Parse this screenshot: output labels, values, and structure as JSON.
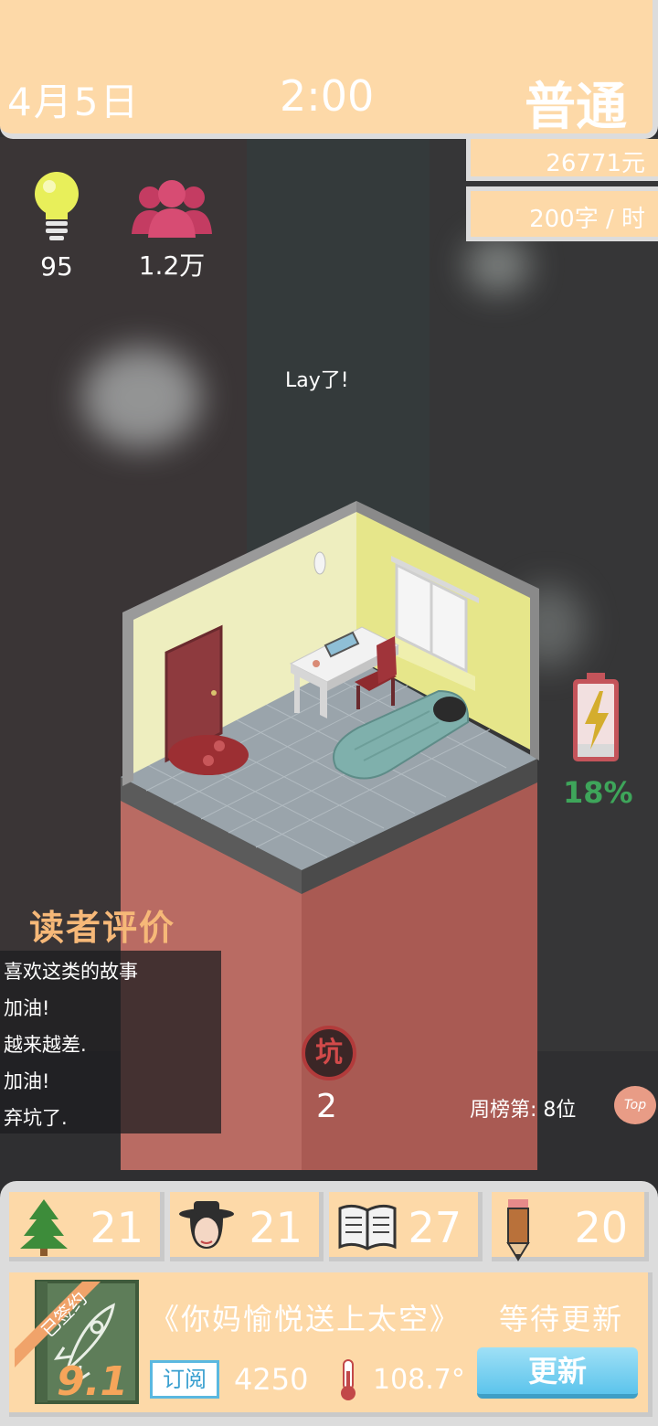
{
  "topbar": {
    "date": "4月5日",
    "time": "2:00",
    "difficulty": "普通"
  },
  "money": "26771元",
  "speed": "200字 / 时",
  "stats": {
    "inspiration": "95",
    "fans": "1.2万"
  },
  "speech": "Lay了!",
  "battery": {
    "percent_label": "18%",
    "level": 0.18
  },
  "reviews": {
    "title": "读者评价",
    "items": [
      "喜欢这类的故事",
      "加油!",
      "越来越差.",
      "加油!",
      "弃坑了."
    ]
  },
  "pit": {
    "icon_char": "坑",
    "count": "2"
  },
  "rank": {
    "label": "周榜第: 8位",
    "top_button": "Top"
  },
  "attributes": [
    {
      "icon": "tree-icon",
      "value": "21"
    },
    {
      "icon": "character-icon",
      "value": "21"
    },
    {
      "icon": "book-icon",
      "value": "27"
    },
    {
      "icon": "pencil-icon",
      "value": "20"
    }
  ],
  "book": {
    "title": "《你妈愉悦送上太空》",
    "status": "等待更新",
    "signed_badge": "已签约",
    "score": "9.1",
    "subscribe_label": "订阅",
    "subscribers": "4250",
    "heat": "108.7°",
    "update_label": "更新"
  }
}
